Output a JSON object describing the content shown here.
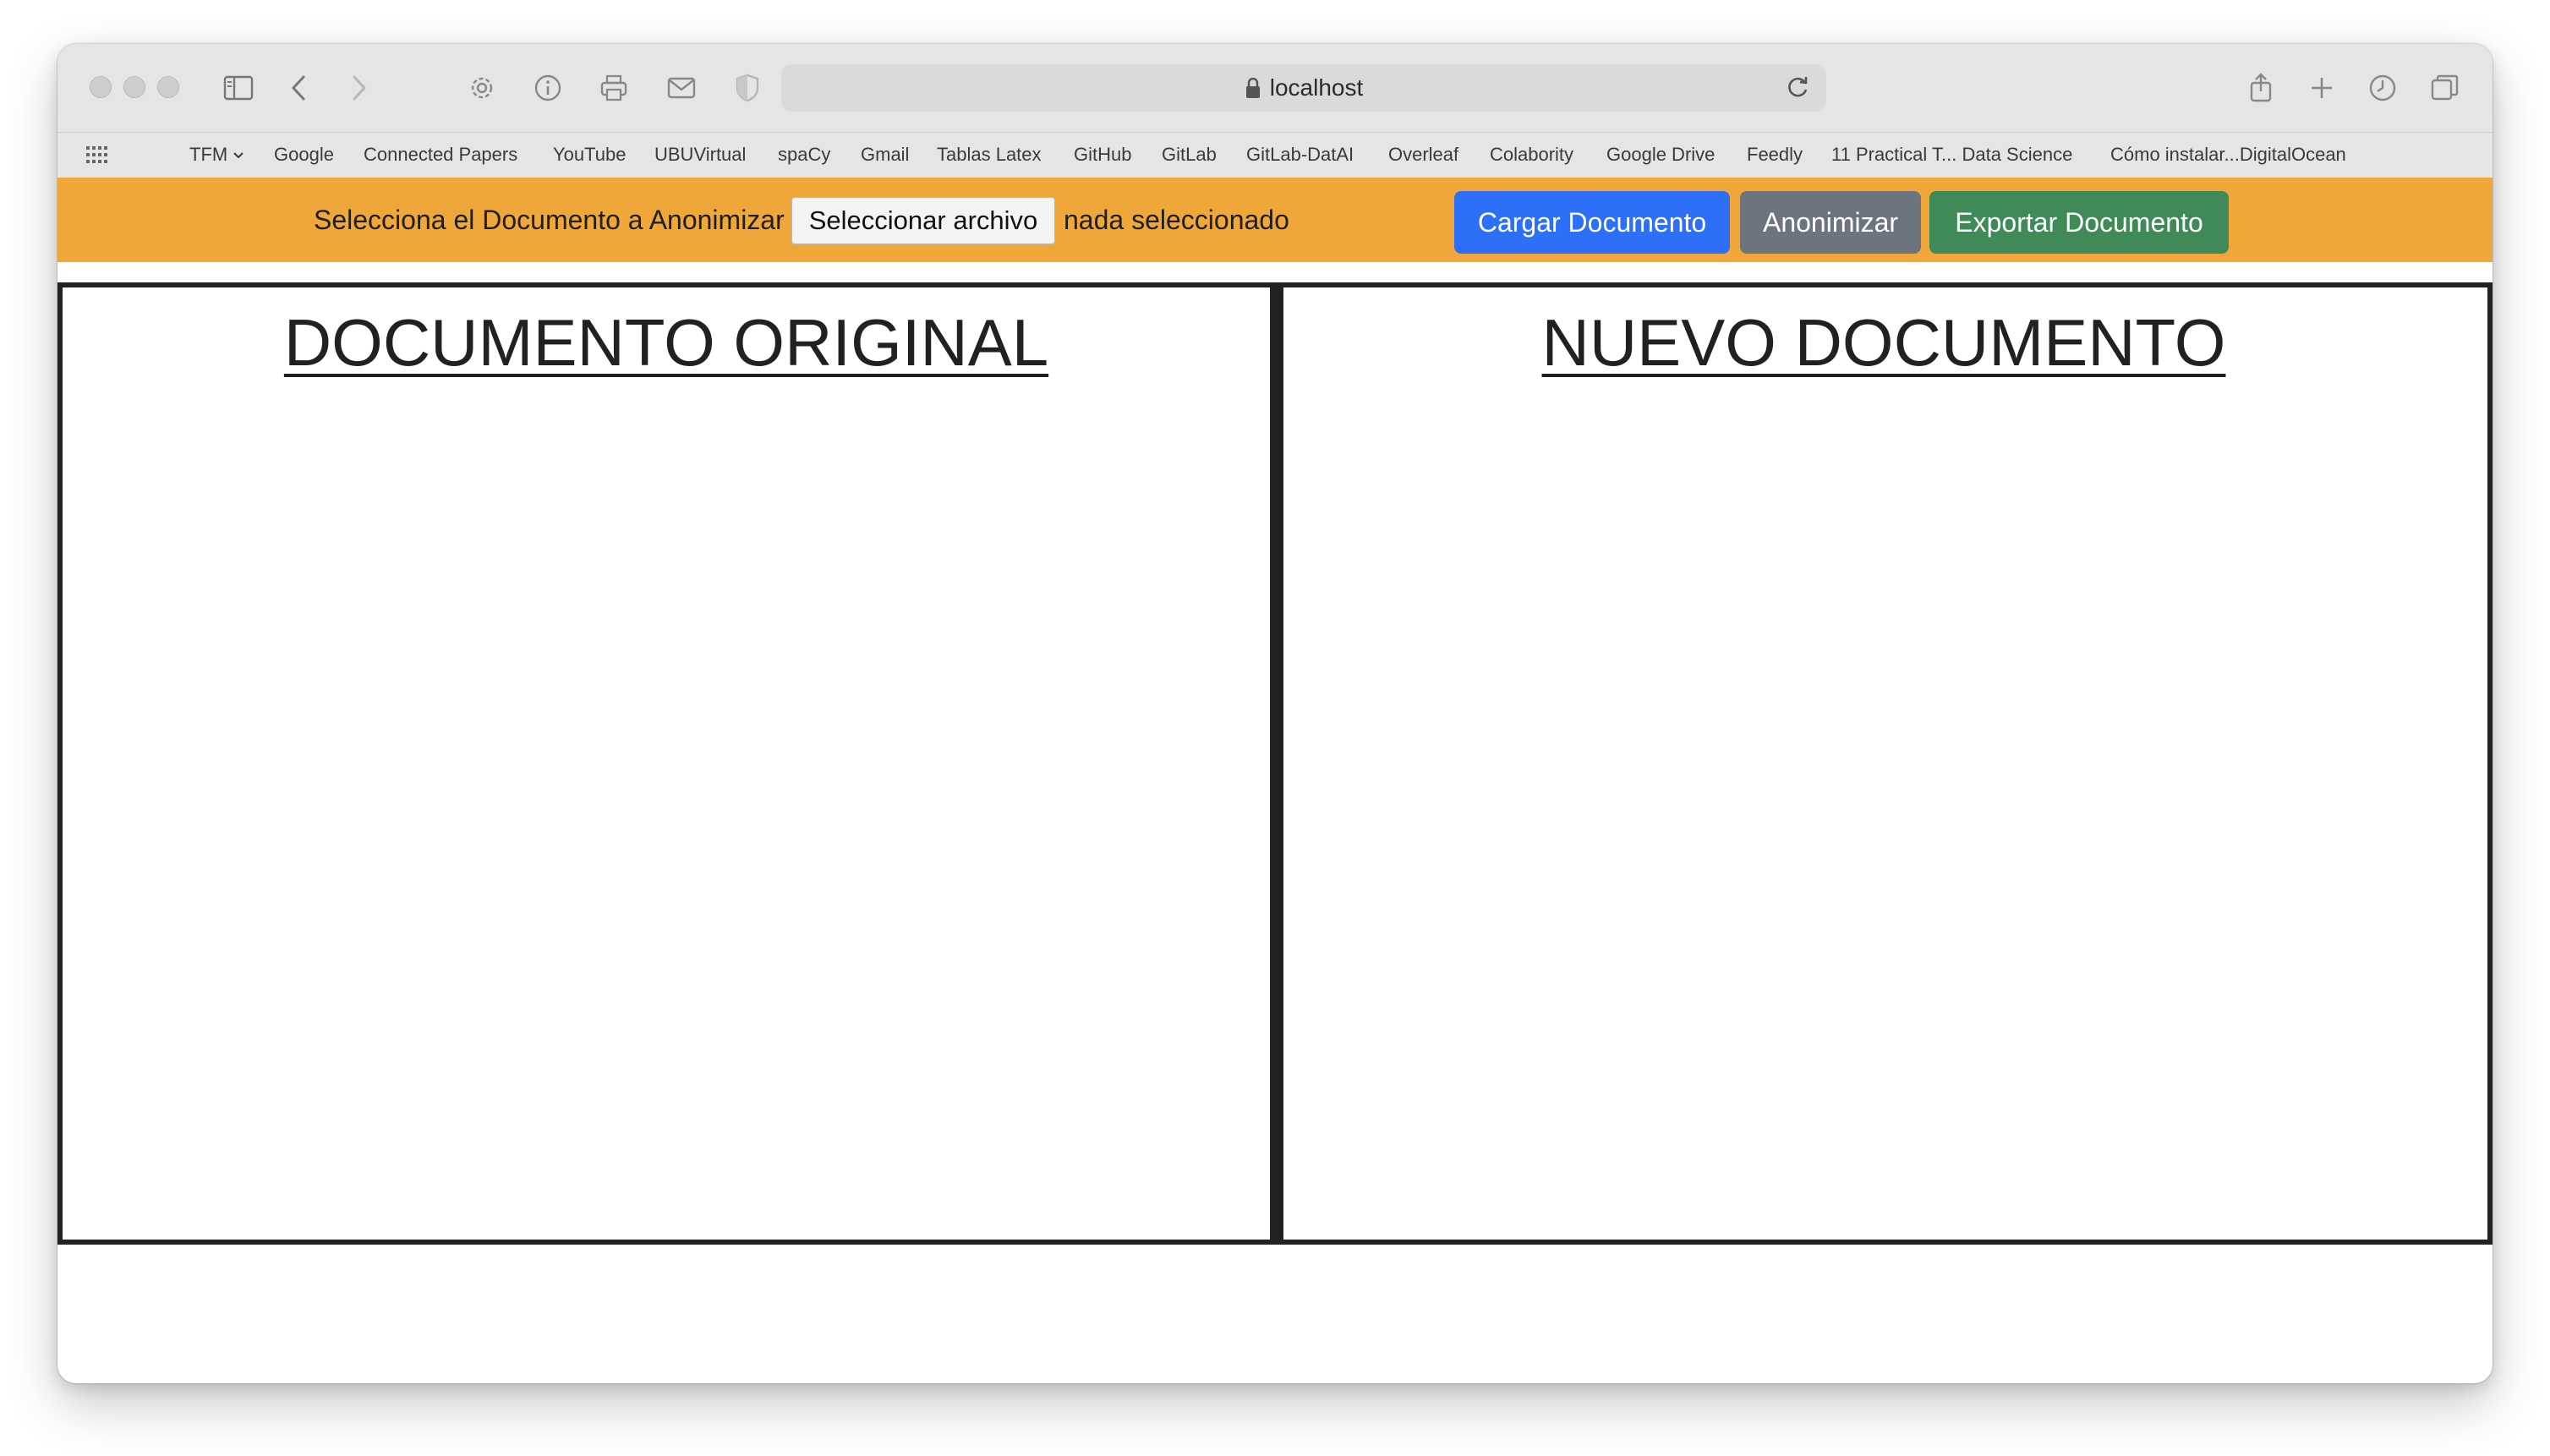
{
  "browser": {
    "url": "localhost",
    "icons": {
      "sidebar": "sidebar-icon",
      "back": "chevron-left-icon",
      "forward": "chevron-right-icon",
      "settings": "gear-icon",
      "info": "info-icon",
      "print": "printer-icon",
      "mail": "envelope-icon",
      "privacy": "shield-icon",
      "reload": "reload-icon",
      "share": "share-icon",
      "new_tab": "plus-icon",
      "history": "clock-icon",
      "tabs": "tab-overview-icon"
    }
  },
  "favorites": [
    "TFM",
    "Google",
    "Connected Papers",
    "YouTube",
    "UBUVirtual",
    "spaCy",
    "Gmail",
    "Tablas Latex",
    "GitHub",
    "GitLab",
    "GitLab-DatAI",
    "Overleaf",
    "Colabority",
    "Google Drive",
    "Feedly",
    "11 Practical T... Data Science",
    "Cómo instalar...DigitalOcean"
  ],
  "app": {
    "header_color": "#f0a73a",
    "select_label": "Selecciona el Documento a Anonimizar",
    "file_button": "Seleccionar archivo",
    "file_status": "nada seleccionado",
    "buttons": {
      "load": "Cargar Documento",
      "anonymize": "Anonimizar",
      "export": "Exportar Documento"
    },
    "button_colors": {
      "load": "#2d6ff6",
      "anonymize": "#6c757d",
      "export": "#3f8a57"
    },
    "panels": {
      "original_title": "DOCUMENTO ORIGINAL",
      "new_title": "NUEVO DOCUMENTO"
    }
  }
}
